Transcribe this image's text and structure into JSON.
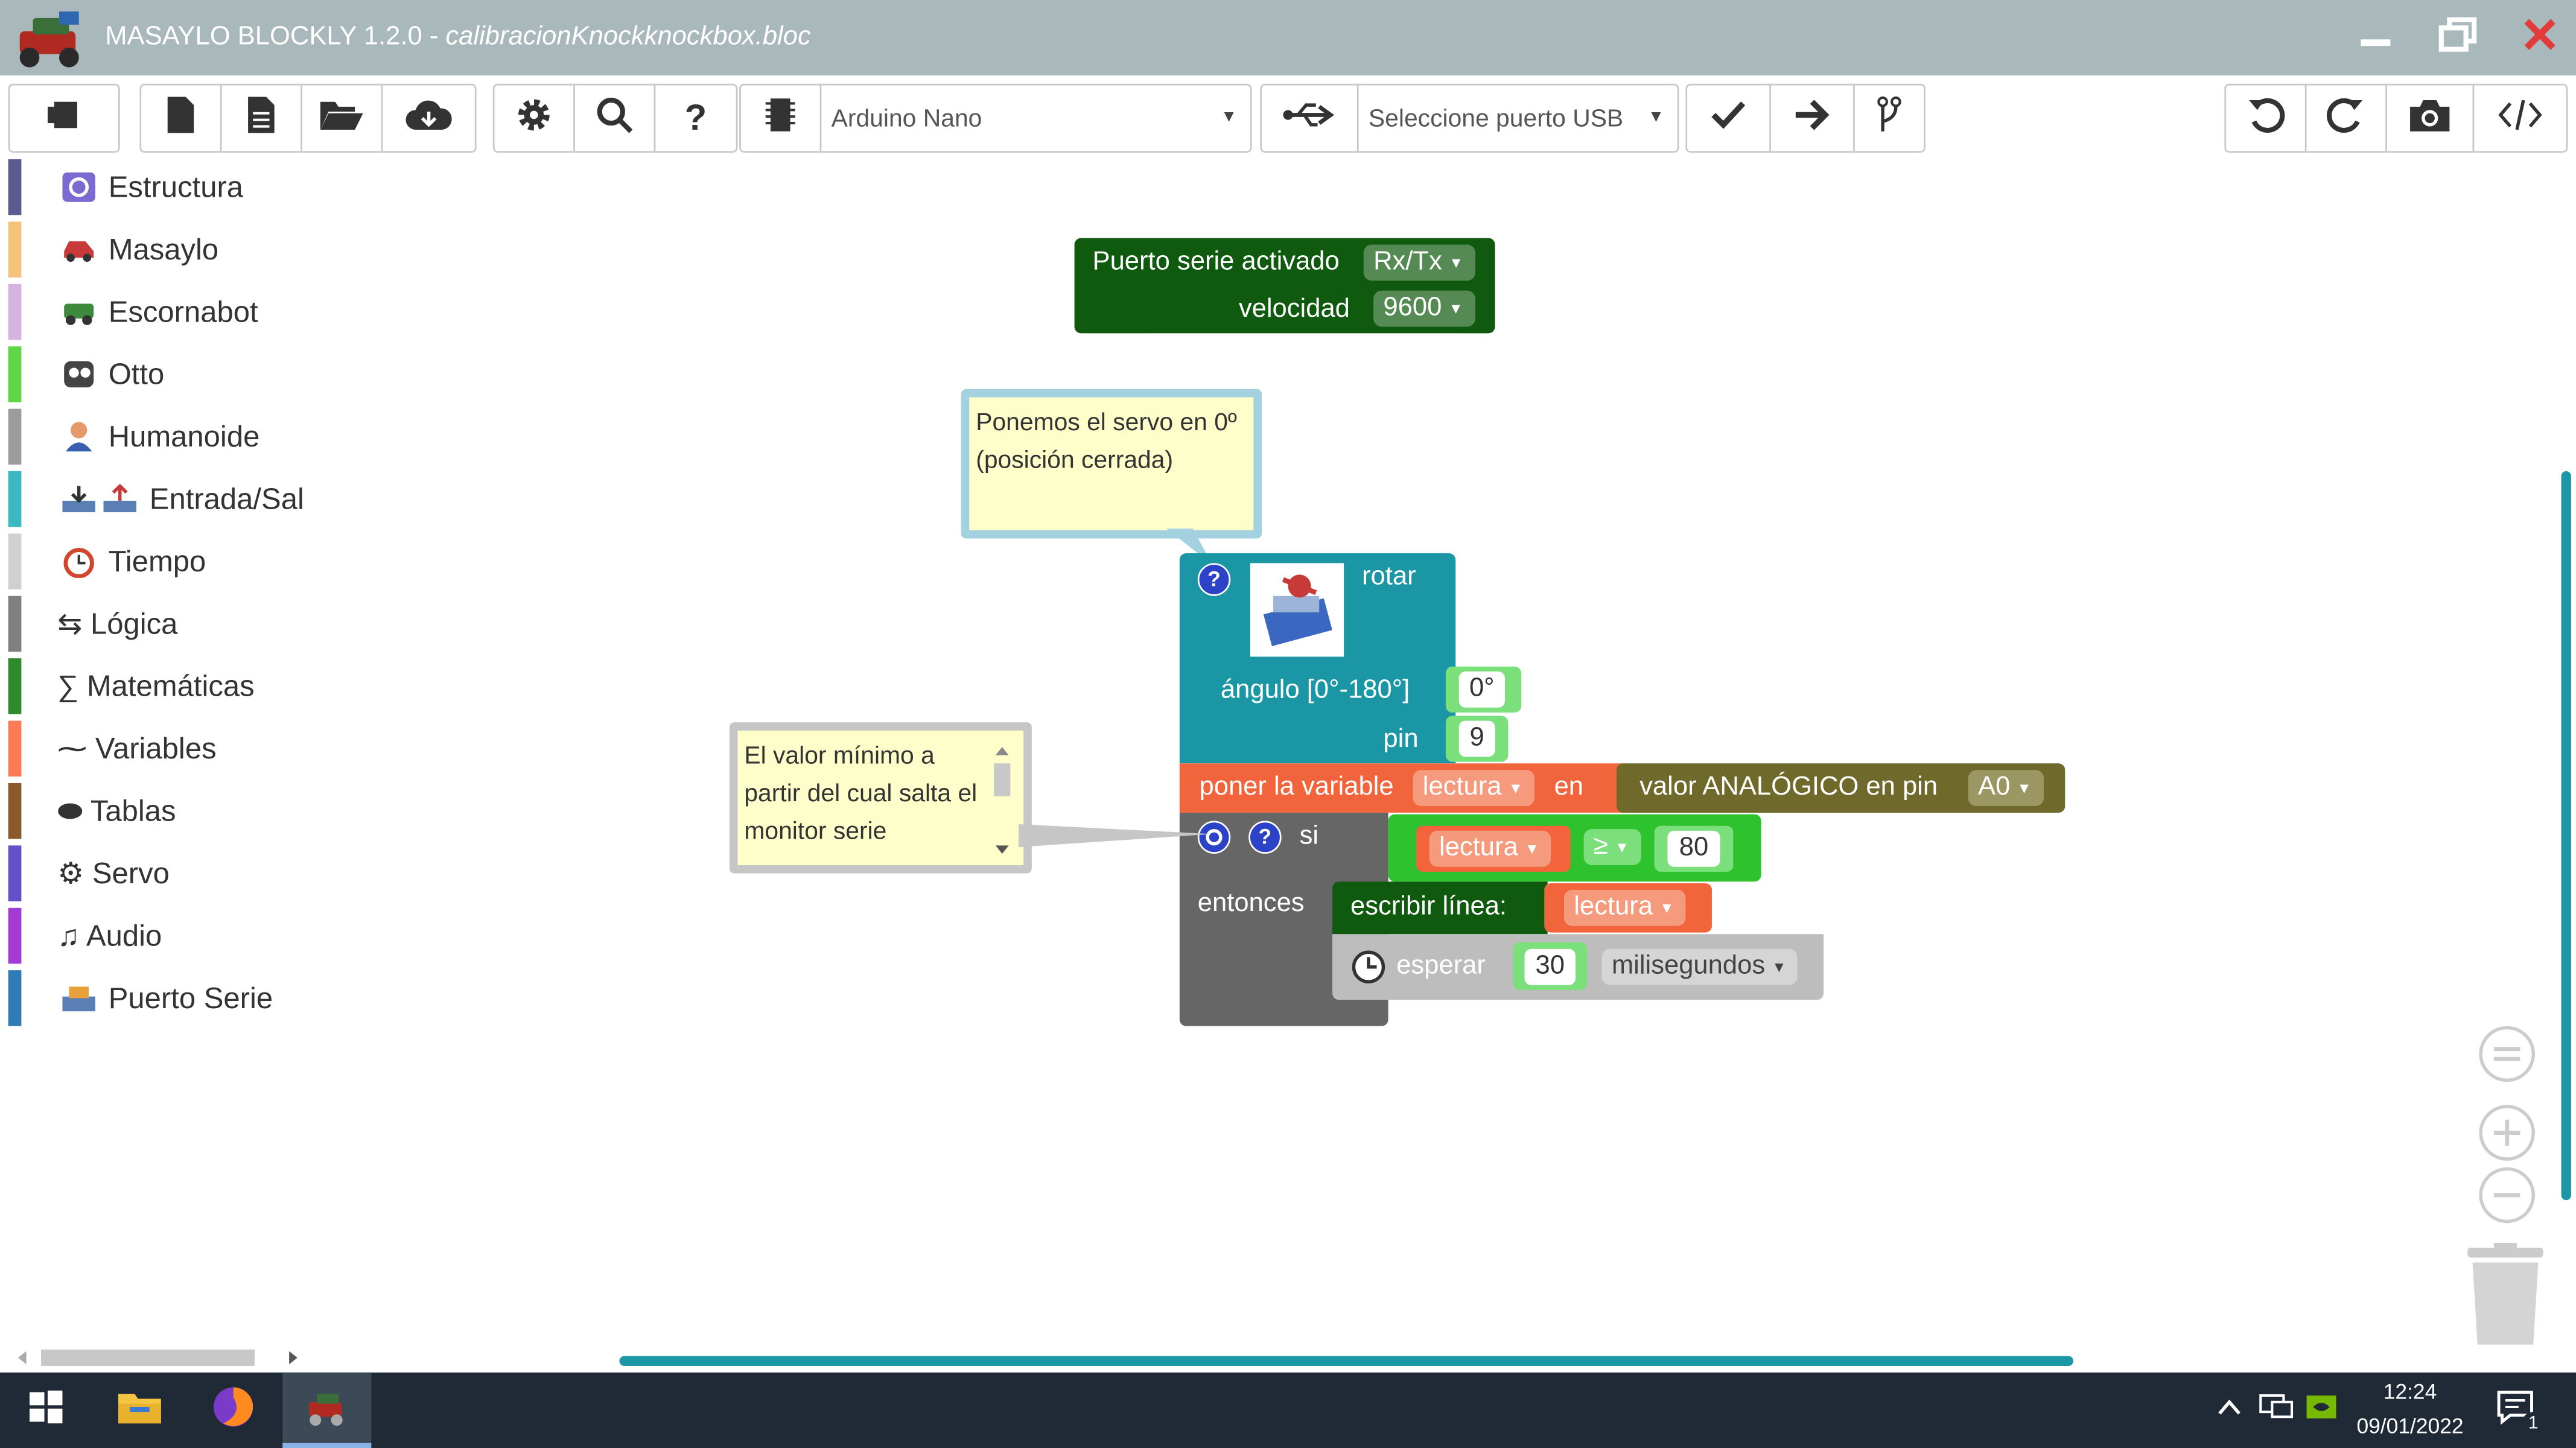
{
  "window": {
    "app_name": "MASAYLO BLOCKLY 1.2.0",
    "separator": " - ",
    "file_name": "calibracionKnockknockbox.bloc",
    "minimize_icon": "minimize-icon",
    "restore_icon": "restore-icon",
    "close_icon": "close-icon"
  },
  "toolbar": {
    "board_select": "Arduino Nano",
    "port_select": "Seleccione puerto USB",
    "icons": [
      "sidebar-toggle-icon",
      "new-file-icon",
      "new-document-icon",
      "open-folder-icon",
      "cloud-download-icon",
      "settings-gear-icon",
      "search-icon",
      "help-icon",
      "board-chip-icon",
      "usb-icon",
      "verify-check-icon",
      "upload-arrow-icon",
      "branch-icon",
      "undo-icon",
      "redo-icon",
      "camera-icon",
      "code-icon"
    ]
  },
  "sidebar": {
    "categories": [
      {
        "label": "Estructura",
        "color": "#5b5b8f"
      },
      {
        "label": "Masaylo",
        "color": "#f4c27a"
      },
      {
        "label": "Escornabot",
        "color": "#d6b3e0"
      },
      {
        "label": "Otto",
        "color": "#5ed645"
      },
      {
        "label": "Humanoide",
        "color": "#9a9ca0"
      },
      {
        "label": "Entrada/Sal",
        "color": "#3bb8c1"
      },
      {
        "label": "Tiempo",
        "color": "#d0d0d0"
      },
      {
        "label": "⇆ Lógica",
        "color": "#808080"
      },
      {
        "label": "∑ Matemáticas",
        "color": "#2e8b2e"
      },
      {
        "label": "⁓ Variables",
        "color": "#fa7b56"
      },
      {
        "label": "⬬ Tablas",
        "color": "#8a5a2b"
      },
      {
        "label": "⚙ Servo",
        "color": "#6351c9"
      },
      {
        "label": "♫ Audio",
        "color": "#a33ad6"
      },
      {
        "label": "Puerto Serie",
        "color": "#2e7bb5"
      }
    ]
  },
  "workspace": {
    "serial_block": {
      "label": "Puerto serie activado",
      "mode": "Rx/Tx",
      "speed_label": "velocidad",
      "speed": "9600"
    },
    "comment_servo": "Ponemos el servo en 0º (posición cerrada)",
    "comment_threshold": "El valor mínimo a partir del cual salta el monitor serie",
    "servo_block": {
      "label": "rotar",
      "angle_label": "ángulo [0°-180°]",
      "angle": "0°",
      "pin_label": "pin",
      "pin": "9",
      "help": "?"
    },
    "set_var_block": {
      "label": "poner la variable",
      "variable": "lectura",
      "in_label": "en",
      "analog_label": "valor ANALÓGICO en pin",
      "analog_pin": "A0"
    },
    "if_block": {
      "if_label": "si",
      "then_label": "entonces",
      "help": "?",
      "var": "lectura",
      "op": "≥",
      "value": "80"
    },
    "print_block": {
      "label": "escribir línea:",
      "var": "lectura"
    },
    "wait_block": {
      "label": "esperar",
      "value": "30",
      "unit": "milisegundos"
    }
  },
  "taskbar": {
    "time": "12:24",
    "date": "09/01/2022",
    "notification_count": "1"
  },
  "colors": {
    "titlebar": "#a9b8bb",
    "servo_block": "#1b96a5",
    "variable_block": "#f2643c",
    "analog_block": "#6f6a2c",
    "logic_block": "#666666",
    "compare_block": "#2ec22e",
    "serial_block": "#0f5a0f",
    "time_block": "#bdbdbd",
    "accent": "#1b97a5"
  }
}
